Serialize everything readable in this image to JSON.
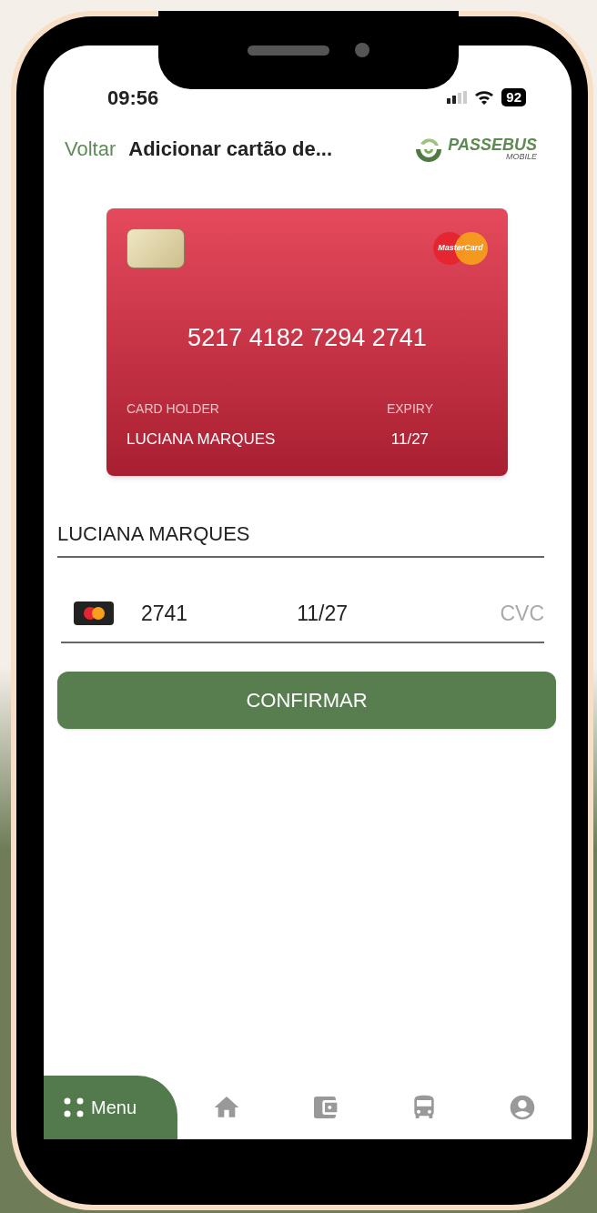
{
  "status_bar": {
    "time": "09:56",
    "battery": "92"
  },
  "header": {
    "back": "Voltar",
    "title": "Adicionar cartão de...",
    "logo": {
      "name": "PASSEBUS",
      "sub": "MOBILE"
    }
  },
  "card": {
    "brand": "MasterCard",
    "number": "5217 4182 7294 2741",
    "holder_label": "CARD HOLDER",
    "holder": "LUCIANA MARQUES",
    "expiry_label": "EXPIRY",
    "expiry": "11/27"
  },
  "form": {
    "name_value": "LUCIANA MARQUES",
    "card_last4": "2741",
    "expiry_value": "11/27",
    "cvc_placeholder": "CVC",
    "confirm": "CONFIRMAR"
  },
  "bottom_nav": [
    {
      "label": "Menu",
      "selected": true
    },
    {
      "selected": false
    },
    {
      "selected": false
    },
    {
      "selected": false
    },
    {
      "selected": false
    }
  ]
}
